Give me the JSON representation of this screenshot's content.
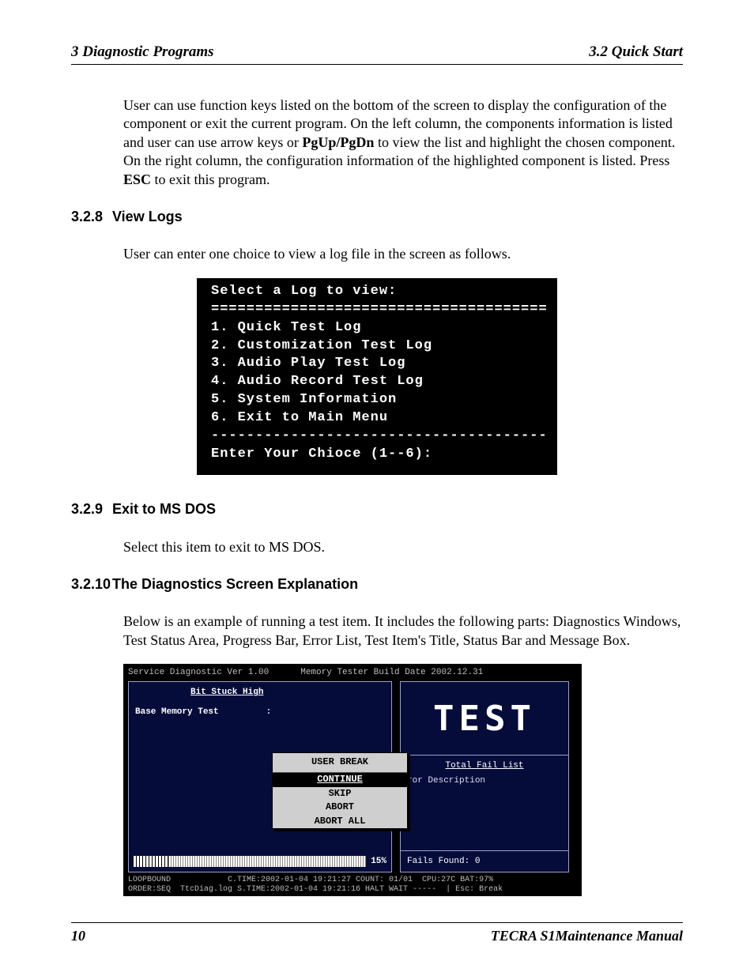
{
  "header": {
    "left": "3  Diagnostic Programs",
    "right": "3.2 Quick Start"
  },
  "intro_parts": {
    "p1": "User can use function keys listed on the bottom of the screen to display the configuration of the component or exit the current program. On the left column, the components information is listed and user can use arrow keys or ",
    "b1": "PgUp/PgDn",
    "p2": " to view the list and highlight the chosen component. On the right column, the configuration information of the highlighted component is listed. Press ",
    "b2": "ESC",
    "p3": " to exit this program."
  },
  "s328": {
    "num": "3.2.8",
    "title": "View Logs",
    "para": "User can enter one choice to view a log file in the screen as follows."
  },
  "term1": {
    "l0": "Select a Log to view:",
    "l1": "======================================",
    "l2": "1. Quick Test Log",
    "l3": "2. Customization Test Log",
    "l4": "3. Audio Play Test Log",
    "l5": "4. Audio Record Test Log",
    "l6": "5. System Information",
    "l7": "6. Exit to Main Menu",
    "l8": "--------------------------------------",
    "l9": "Enter Your Chioce (1--6):"
  },
  "s329": {
    "num": "3.2.9",
    "title": "Exit to MS DOS",
    "para": "Select this item to exit to MS DOS."
  },
  "s3210": {
    "num": "3.2.10",
    "title": "The Diagnostics Screen Explanation",
    "para": "Below is an example of running a test item. It includes the following parts: Diagnostics Windows, Test Status Area, Progress Bar, Error List, Test Item's Title, Status Bar and Message Box."
  },
  "diag": {
    "title_left": "Service Diagnostic Ver 1.00",
    "title_right": "Memory Tester Build Date 2002.12.31",
    "bit_stuck": "Bit Stuck High",
    "base_mem": "Base Memory Test",
    "colon": ":",
    "test": "TEST",
    "tfl": "Total Fail List",
    "desc_cols": "ror  Description",
    "fails": "Fails Found: 0",
    "progress_pct": "15%",
    "modal": {
      "title": "USER BREAK",
      "o1": "CONTINUE",
      "o2": "SKIP",
      "o3": "ABORT",
      "o4": "ABORT ALL"
    },
    "status1": "LOOPBOUND            C.TIME:2002-01-04 19:21:27 COUNT: 01/01  CPU:27C BAT:97%",
    "status2": "ORDER:SEQ  TtcDiag.log S.TIME:2002-01-04 19:21:16 HALT WAIT -----  | Esc: Break"
  },
  "footer": {
    "page": "10",
    "manual": "TECRA S1Maintenance Manual"
  }
}
